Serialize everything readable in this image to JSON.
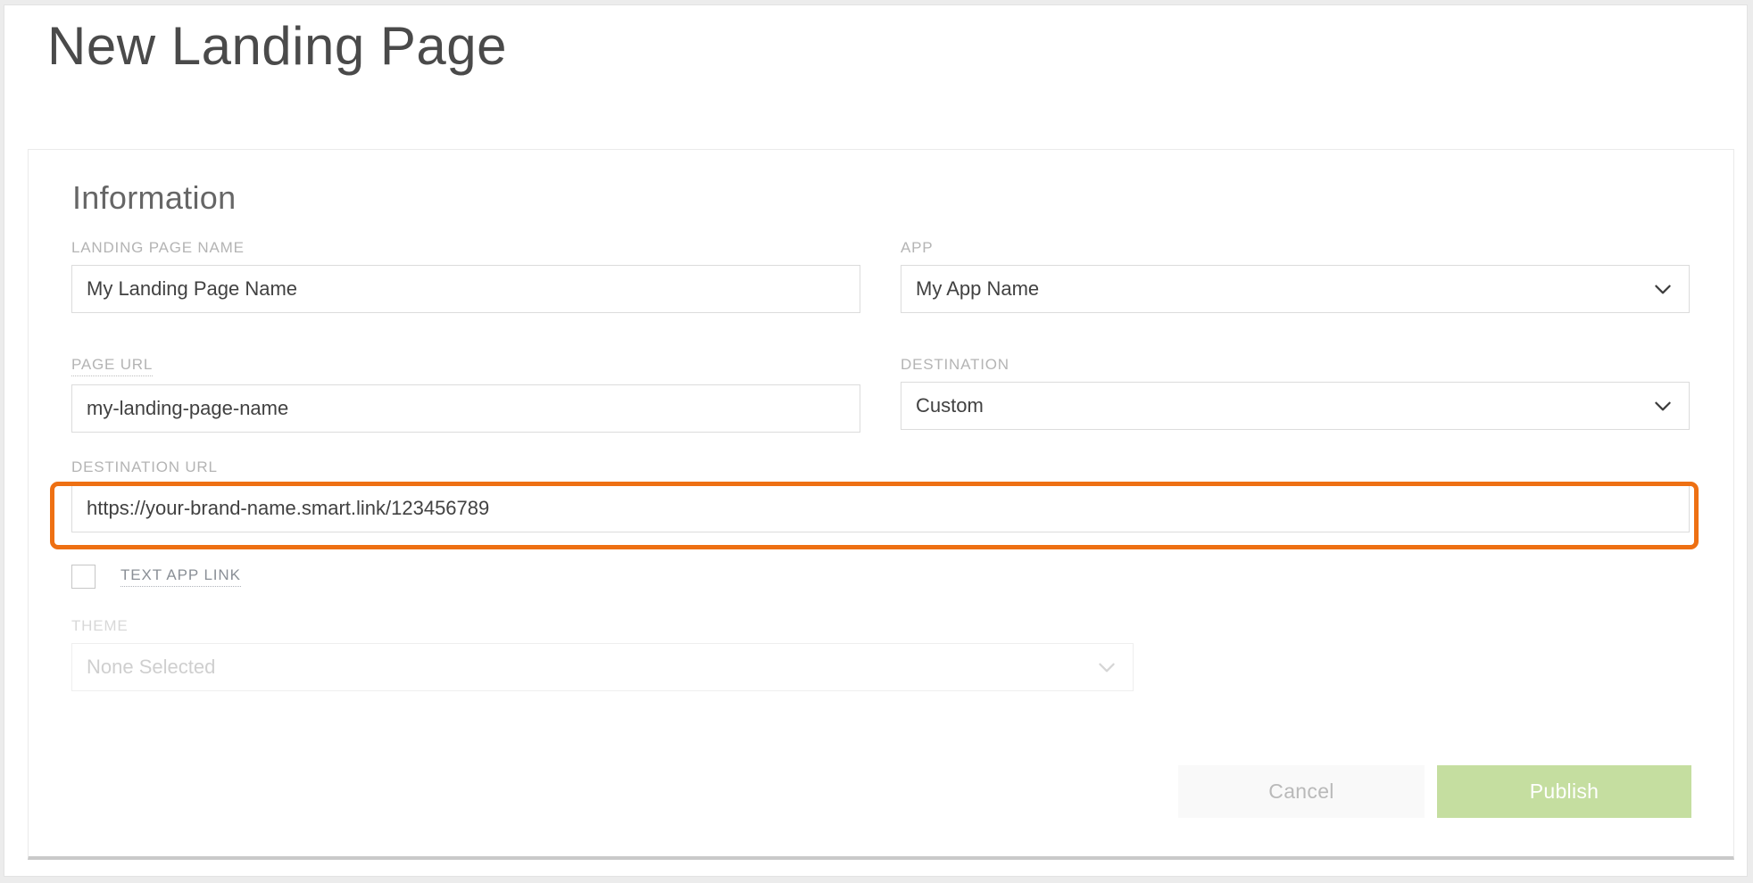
{
  "page": {
    "title": "New Landing Page"
  },
  "card": {
    "section_title": "Information",
    "fields": {
      "landing_page_name": {
        "label": "LANDING PAGE NAME",
        "value": "My Landing Page Name",
        "type": "text"
      },
      "app": {
        "label": "APP",
        "value": "My App Name",
        "type": "select",
        "icon": "chevron-down-icon"
      },
      "page_url": {
        "label": "PAGE URL",
        "value": "my-landing-page-name",
        "type": "text",
        "label_has_hint_underline": true
      },
      "destination": {
        "label": "DESTINATION",
        "value": "Custom",
        "type": "select",
        "icon": "chevron-down-icon"
      },
      "destination_url": {
        "label": "DESTINATION URL",
        "value": "https://your-brand-name.smart.link/123456789",
        "type": "text",
        "highlighted": true
      },
      "text_app_link": {
        "label": "TEXT APP LINK",
        "checked": false,
        "type": "checkbox",
        "label_has_hint_underline": true
      },
      "theme": {
        "label": "THEME",
        "value": "None Selected",
        "type": "select",
        "disabled": true,
        "icon": "chevron-down-icon"
      }
    },
    "actions": {
      "cancel_label": "Cancel",
      "publish_label": "Publish"
    }
  },
  "colors": {
    "annotation_highlight": "#ee7013",
    "publish_button": "#c5dea0",
    "cancel_button": "#f9f9f9",
    "label_text": "#b4b4b4",
    "page_background": "#ececec"
  }
}
